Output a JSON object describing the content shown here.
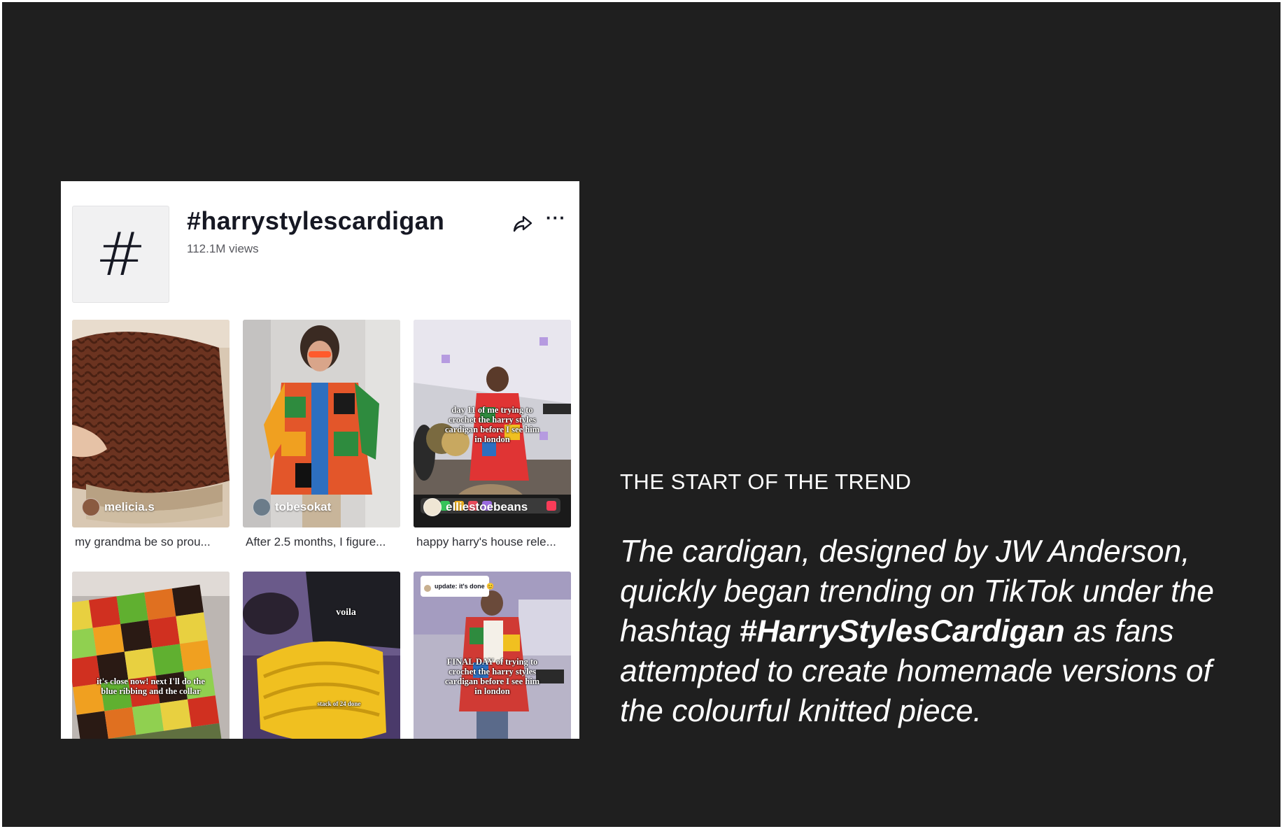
{
  "hashtag_page": {
    "hash_symbol": "#",
    "title": "#harrystylescardigan",
    "views": "112.1M views",
    "videos": [
      {
        "author": "melicia.s",
        "caption": "my grandma be so prou...",
        "overlay": ""
      },
      {
        "author": "tobesokat",
        "caption": "After 2.5 months, I figure...",
        "overlay": ""
      },
      {
        "author": "elliestoebeans",
        "caption": "happy harry's house rele...",
        "overlay": "day 11 of me trying to crochet the harry styles cardigan before I see him in london"
      },
      {
        "author": "",
        "caption": "",
        "overlay": "it's close now! next I'll do the blue ribbing and the collar"
      },
      {
        "author": "",
        "caption": "",
        "overlay": "voila",
        "overlay2": "stack of 24 done"
      },
      {
        "author": "",
        "caption": "",
        "overlay": "FINAL DAY of trying to crochet the harry styles cardigan before I see him in london",
        "reply_label": "update: it's done 😊"
      }
    ],
    "icons": {
      "share": "share-icon",
      "more": "more-icon"
    }
  },
  "slide": {
    "section_label": "THE START OF THE TREND",
    "body_part1": "The cardigan, designed by JW Anderson, quickly began trending on TikTok under the hashtag ",
    "body_hashtag": "#HarryStylesCardigan",
    "body_part2": " as fans attempted to create homemade versions of the colourful knitted piece."
  },
  "colors": {
    "slide_background": "#1f1f1f",
    "card_background": "#ffffff",
    "text_primary": "#161823"
  }
}
